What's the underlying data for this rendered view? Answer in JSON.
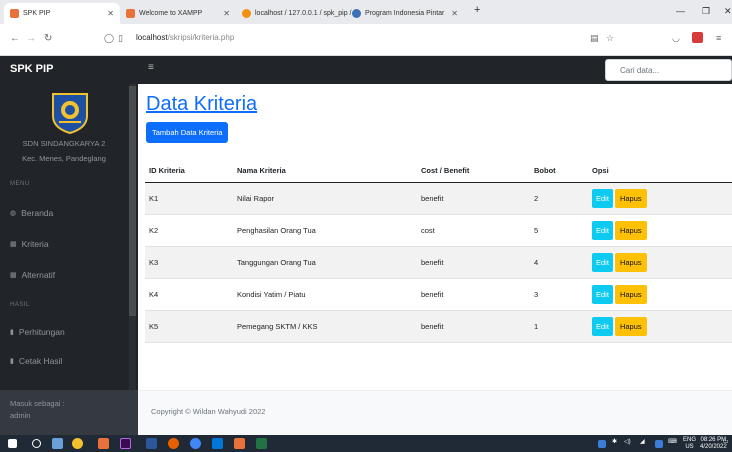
{
  "browser": {
    "tabs": [
      {
        "label": "SPK PIP",
        "active": true
      },
      {
        "label": "Welcome to XAMPP",
        "active": false
      },
      {
        "label": "localhost / 127.0.0.1 / spk_pip / ×",
        "active": false
      },
      {
        "label": "Program Indonesia Pintar",
        "active": false
      }
    ],
    "url_host": "localhost",
    "url_path": "/skripsi/kriteria.php"
  },
  "navbar": {
    "brand": "SPK PIP",
    "search_placeholder": "Cari data..."
  },
  "sidebar": {
    "school_name": "SDN SINDANGKARYA 2",
    "school_location": "Kec. Menes, Pandeglang",
    "section_menu": "MENU",
    "section_hasil": "HASIL",
    "items": [
      "Beranda",
      "Kriteria",
      "Alternatif",
      "Perhitungan",
      "Cetak Hasil"
    ],
    "footer_label": "Masuk sebagai :",
    "footer_user": "admin"
  },
  "main": {
    "title": "Data Kriteria",
    "add_button": "Tambah Data Kriteria",
    "columns": [
      "ID Kriteria",
      "Nama Kriteria",
      "Cost / Benefit",
      "Bobot",
      "Opsi"
    ],
    "rows": [
      {
        "id": "K1",
        "nama": "Nilai Rapor",
        "tipe": "benefit",
        "bobot": "2"
      },
      {
        "id": "K2",
        "nama": "Penghasilan Orang Tua",
        "tipe": "cost",
        "bobot": "5"
      },
      {
        "id": "K3",
        "nama": "Tanggungan Orang Tua",
        "tipe": "benefit",
        "bobot": "4"
      },
      {
        "id": "K4",
        "nama": "Kondisi Yatim / Piatu",
        "tipe": "benefit",
        "bobot": "3"
      },
      {
        "id": "K5",
        "nama": "Pemegang SKTM / KKS",
        "tipe": "benefit",
        "bobot": "1"
      }
    ],
    "edit_label": "Edit",
    "delete_label": "Hapus",
    "footer": "Copyright © Wildan Wahyudi 2022"
  },
  "taskbar": {
    "lang": "ENG",
    "region": "US",
    "time": "08:26 PM",
    "date": "4/20/2022"
  },
  "colors": {
    "primary": "#0d6efd",
    "info": "#0dcaf0",
    "warning": "#ffc107",
    "dark": "#212529"
  }
}
